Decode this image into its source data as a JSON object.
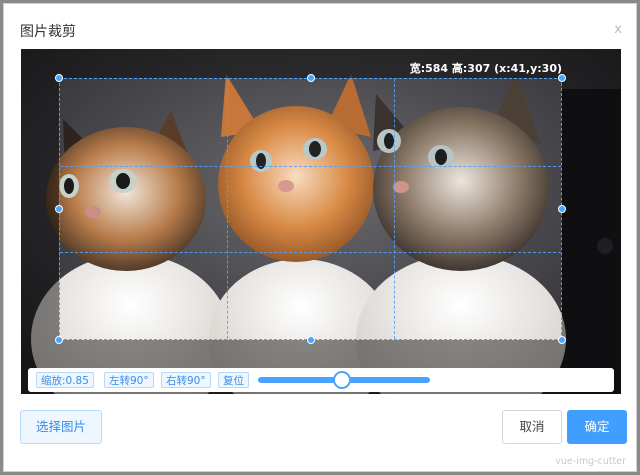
{
  "dialog": {
    "title": "图片裁剪",
    "close_label": "x"
  },
  "cropper": {
    "size_info": "宽:584 高:307 (x:41,y:30)",
    "image_description": "three kittens"
  },
  "toolbar": {
    "zoom_label": "缩放:0.85",
    "rotate_left_label": "左转90°",
    "rotate_right_label": "右转90°",
    "reset_label": "复位",
    "zoom_slider_fraction": 0.49
  },
  "footer": {
    "select_label": "选择图片",
    "cancel_label": "取消",
    "confirm_label": "确定",
    "watermark": "vue-img-cutter"
  },
  "colors": {
    "accent": "#409eff",
    "handle": "#4aa3ff"
  }
}
